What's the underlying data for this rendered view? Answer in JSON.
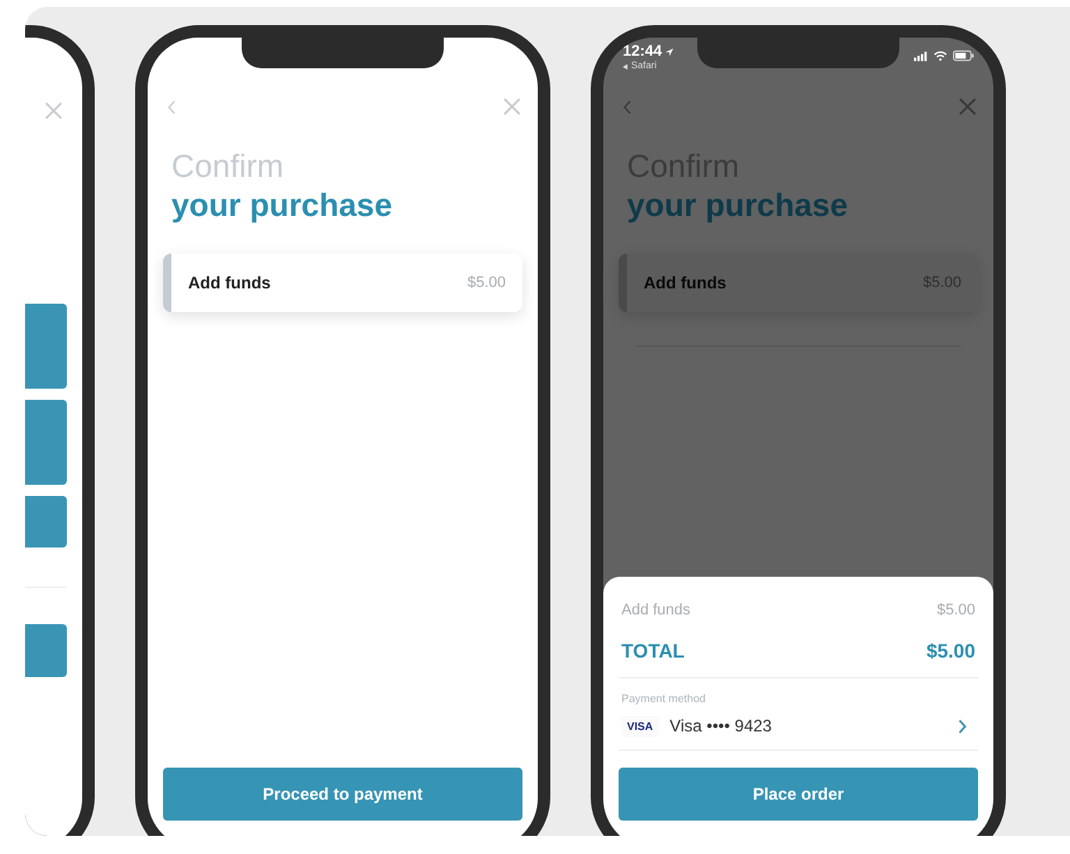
{
  "phones": [
    {
      "kind": "cropped"
    },
    {
      "kind": "confirm",
      "dimmed": false,
      "title_light": "Confirm",
      "title_bold": "your purchase",
      "items": [
        {
          "label": "Add funds",
          "amount": "$5.00"
        }
      ],
      "button": "Proceed to payment"
    },
    {
      "kind": "confirm",
      "dimmed": true,
      "status_bar": {
        "time": "12:44",
        "back_app": "Safari"
      },
      "title_light": "Confirm",
      "title_bold": "your purchase",
      "items": [
        {
          "label": "Add funds",
          "amount": "$5.00"
        }
      ],
      "sheet": {
        "lines": [
          {
            "kind": "line",
            "label": "Add funds",
            "amount": "$5.00"
          },
          {
            "kind": "total",
            "label": "TOTAL",
            "amount": "$5.00"
          }
        ],
        "payment_label": "Payment method",
        "card_brand": "VISA",
        "card_text": "Visa •••• 9423"
      },
      "button": "Place order"
    }
  ]
}
